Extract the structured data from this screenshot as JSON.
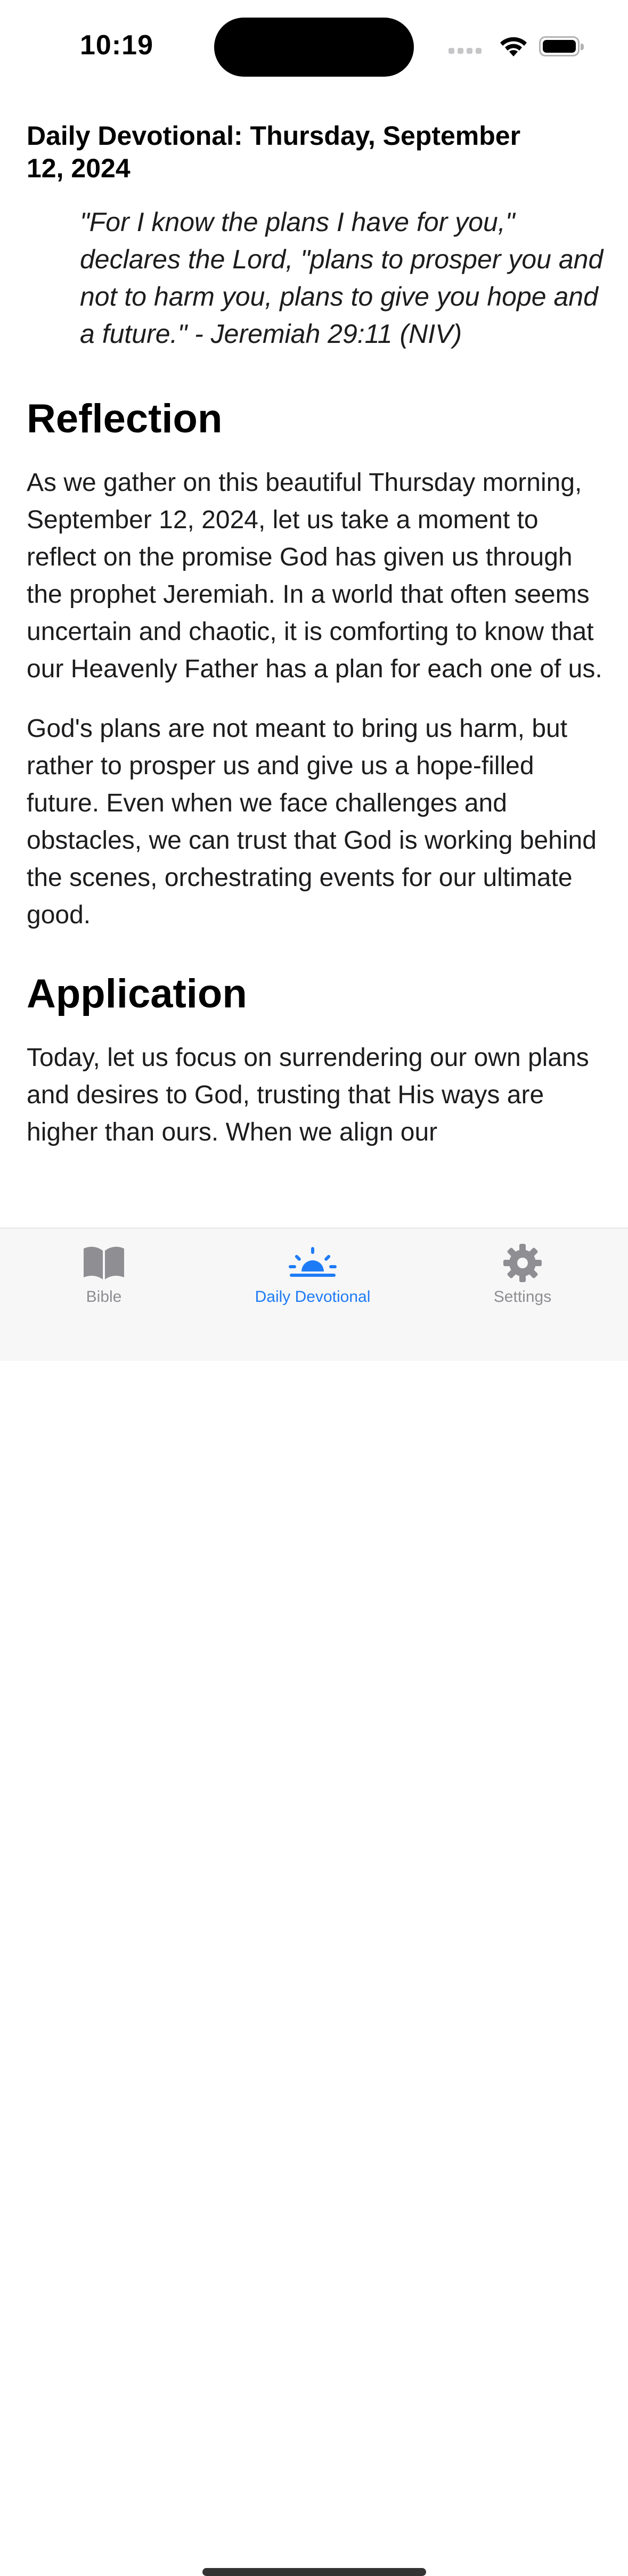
{
  "status_bar": {
    "time": "10:19"
  },
  "devotional": {
    "title": "Daily Devotional: Thursday, September 12, 2024",
    "verse": "\"For I know the plans I have for you,\" declares the Lord, \"plans to prosper you and not to harm you, plans to give you hope and a future.\" - Jeremiah 29:11 (NIV)",
    "sections": {
      "reflection": {
        "heading": "Reflection",
        "paragraphs": [
          "As we gather on this beautiful Thursday morning, September 12, 2024, let us take a moment to reflect on the promise God has given us through the prophet Jeremiah. In a world that often seems uncertain and chaotic, it is comforting to know that our Heavenly Father has a plan for each one of us.",
          "God's plans are not meant to bring us harm, but rather to prosper us and give us a hope-filled future. Even when we face challenges and obstacles, we can trust that God is working behind the scenes, orchestrating events for our ultimate good."
        ]
      },
      "application": {
        "heading": "Application",
        "paragraphs": [
          "Today, let us focus on surrendering our own plans and desires to God, trusting that His ways are higher than ours. When we align our"
        ]
      }
    }
  },
  "tab_bar": {
    "tabs": [
      {
        "label": "Bible",
        "icon": "book-icon",
        "active": false
      },
      {
        "label": "Daily Devotional",
        "icon": "sunrise-icon",
        "active": true
      },
      {
        "label": "Settings",
        "icon": "gear-icon",
        "active": false
      }
    ]
  },
  "colors": {
    "accent": "#1e7bf6",
    "inactive": "#8e8e93",
    "tab_bar_background": "#f7f7f7"
  }
}
